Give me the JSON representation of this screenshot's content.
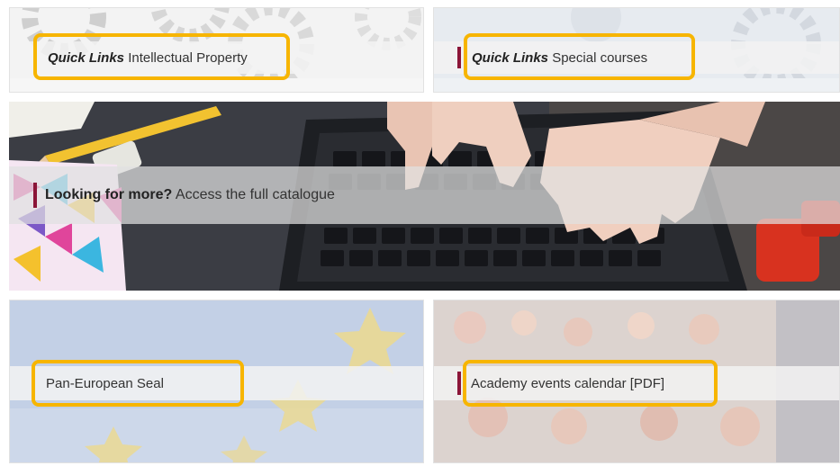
{
  "tiles": {
    "intellectual_property": {
      "emphasis": "Quick Links",
      "label": "Intellectual Property"
    },
    "special_courses": {
      "emphasis": "Quick Links",
      "label": "Special courses"
    },
    "catalogue": {
      "emphasis": "Looking for more?",
      "label": "Access the full catalogue"
    },
    "pan_european_seal": {
      "label": "Pan-European Seal"
    },
    "events_calendar": {
      "label": "Academy events calendar [PDF]"
    }
  },
  "colors": {
    "accent": "#8b1538",
    "highlight": "#f7b500",
    "caption_bar": "#f2f2f2",
    "text": "#333333"
  }
}
